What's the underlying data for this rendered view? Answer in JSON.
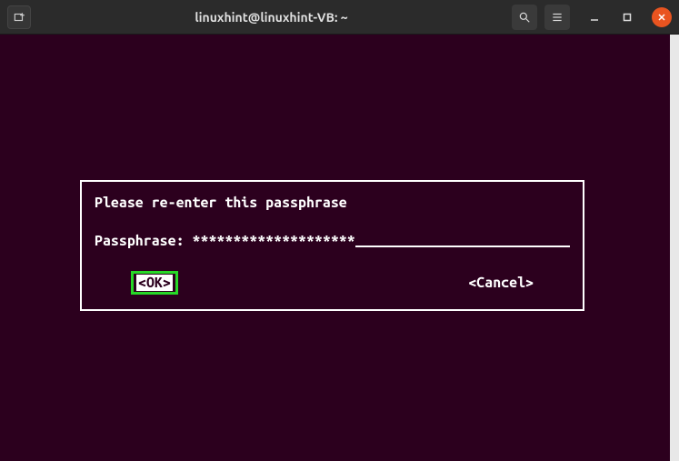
{
  "titlebar": {
    "title": "linuxhint@linuxhint-VB: ~"
  },
  "dialog": {
    "prompt": "Please re-enter this passphrase",
    "passphrase_label": "Passphrase: ",
    "passphrase_value": "********************",
    "ok_label": "<OK>",
    "cancel_label": "<Cancel>"
  }
}
